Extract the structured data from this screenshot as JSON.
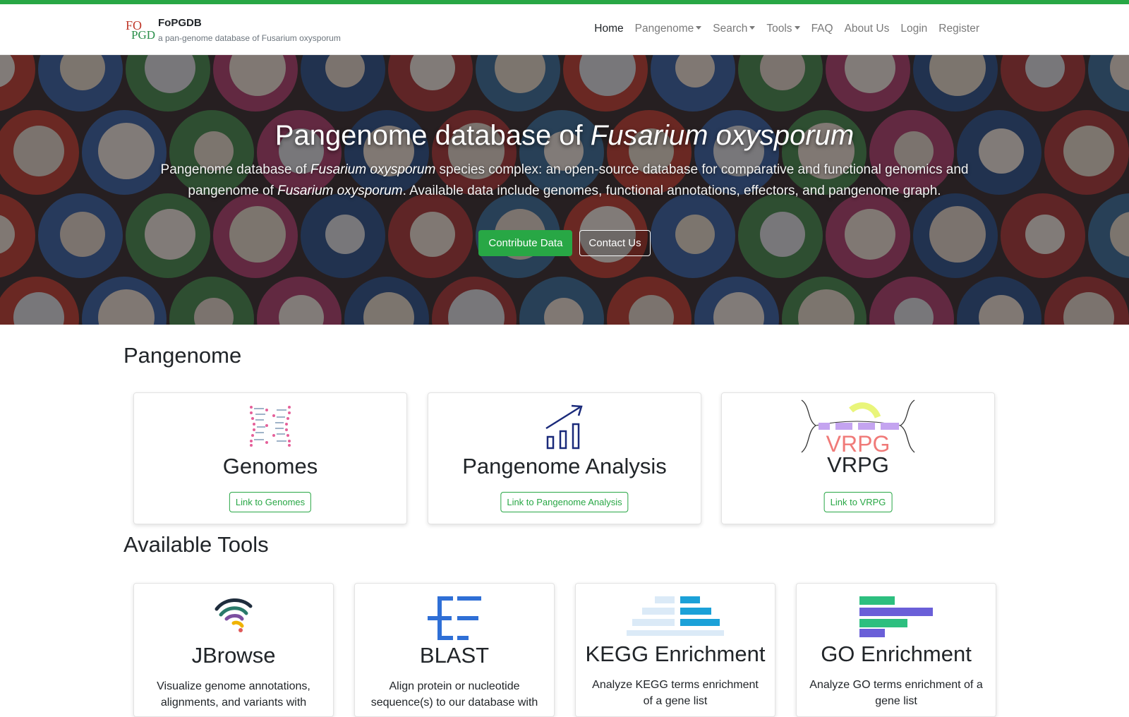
{
  "brand": {
    "name": "FoPGDB",
    "subtitle": "a pan-genome database of Fusarium oxysporum",
    "logo_top": "FO",
    "logo_bottom": "PGD"
  },
  "nav": {
    "home": "Home",
    "pangenome": "Pangenome",
    "search": "Search",
    "tools": "Tools",
    "faq": "FAQ",
    "about": "About Us",
    "login": "Login",
    "register": "Register"
  },
  "hero": {
    "title_prefix": "Pangenome database of ",
    "title_species": "Fusarium oxysporum",
    "desc_part1": "Pangenome database of ",
    "desc_species1": "Fusarium oxysporum",
    "desc_part2": " species complex: an open-source database for comparative and functional genomics and pangenome of ",
    "desc_species2": "Fusarium oxysporum",
    "desc_part3": ". Available data include genomes, functional annotations, effectors, and pangenome graph.",
    "contribute_label": "Contribute Data",
    "contact_label": "Contact Us"
  },
  "pangenome_section": {
    "title": "Pangenome",
    "cards": [
      {
        "title": "Genomes",
        "link_label": "Link to Genomes",
        "icon": "dna-icon"
      },
      {
        "title": "Pangenome Analysis",
        "link_label": "Link to Pangenome Analysis",
        "icon": "growth-chart-icon"
      },
      {
        "title": "VRPG",
        "link_label": "Link to VRPG",
        "icon": "vrpg-logo",
        "logo_text": "VRPG"
      }
    ]
  },
  "tools_section": {
    "title": "Available Tools",
    "cards": [
      {
        "title": "JBrowse",
        "text": "Visualize genome annotations, alignments, and variants with",
        "icon": "jbrowse-icon"
      },
      {
        "title": "BLAST",
        "text": "Align protein or nucleotide sequence(s) to our database with",
        "icon": "blast-icon"
      },
      {
        "title": "KEGG Enrichment",
        "text": "Analyze KEGG terms enrichment of a gene list",
        "icon": "kegg-bars-icon"
      },
      {
        "title": "GO Enrichment",
        "text": "Analyze GO terms enrichment of a gene list",
        "icon": "go-bars-icon"
      }
    ]
  },
  "colors": {
    "accent_green": "#28a745",
    "nav_text": "#7a7a7a",
    "blast_blue": "#2f6fd6",
    "go_purple": "#6a5fd8",
    "go_green": "#2dbf7f"
  }
}
